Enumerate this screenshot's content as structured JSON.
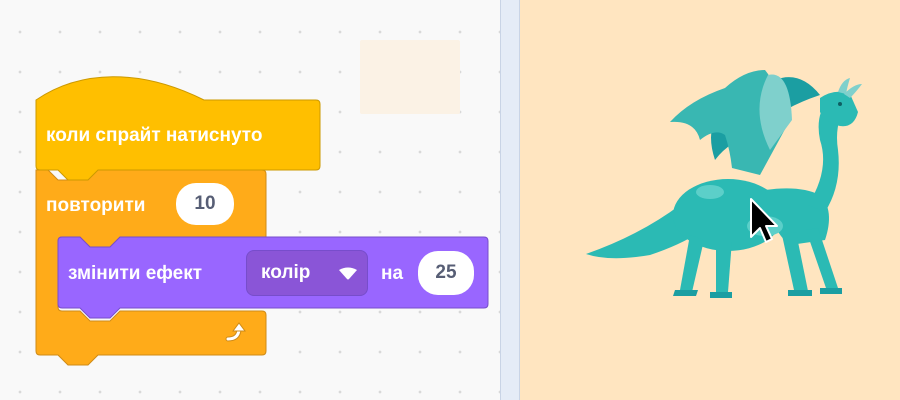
{
  "blocks": {
    "hat": {
      "label": "коли спрайт натиснуто",
      "color": "#ffbf00"
    },
    "repeat": {
      "label": "повторити",
      "count": "10",
      "color": "#ffab19"
    },
    "effect": {
      "label": "змінити ефект",
      "effect": "колір",
      "by_label": "на",
      "amount": "25",
      "color": "#9966ff"
    }
  },
  "icons": {
    "loop": "loop-arrow-icon",
    "dropdown": "dropdown-triangle-icon",
    "cursor": "mouse-pointer-icon",
    "sprite": "dragon-sprite"
  },
  "colors": {
    "stage_background": "#ffe5c0",
    "workspace_background": "#f9f9f9"
  }
}
